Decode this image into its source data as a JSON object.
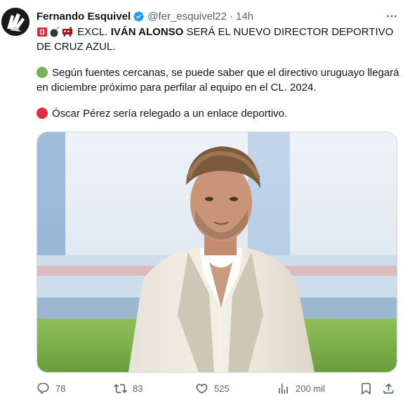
{
  "author": {
    "name": "Fernando Esquivel",
    "handle": "@fer_esquivel22",
    "separator": "·",
    "time": "14h",
    "verified": true
  },
  "tweet": {
    "line1_prefix": "EXCL.",
    "line1_bold": "IVÁN ALONSO",
    "line1_rest": "SERÁ EL NUEVO DIRECTOR DEPORTIVO DE CRUZ AZUL.",
    "para2": "Según fuentes cercanas, se puede saber que el directivo uruguayo llegará en diciembre próximo para perfilar al equipo en el CL. 2024.",
    "para3": "Óscar Pérez sería relegado a un enlace deportivo.",
    "emojis": [
      "rotating-light-icon",
      "bomb-icon",
      "train-icon"
    ]
  },
  "actions": {
    "replies": "78",
    "retweets": "83",
    "likes": "525",
    "views": "200 mil"
  },
  "colors": {
    "text": "#0f1419",
    "secondary": "#536471",
    "verified": "#1d9bf0",
    "green_circle": "#78b159",
    "red_circle": "#dd2e44"
  }
}
